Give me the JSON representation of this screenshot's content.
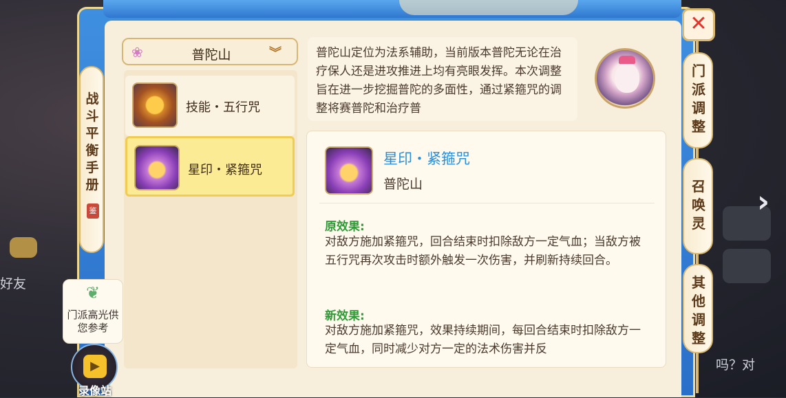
{
  "left_tab": {
    "label": "战斗平衡手册",
    "seal": "鉴"
  },
  "highlight": {
    "label": "门派高光供您参考"
  },
  "video": {
    "label": "录像站"
  },
  "dropdown": {
    "selected": "普陀山"
  },
  "skills": [
    {
      "label": "技能・五行咒"
    },
    {
      "label": "星印・紧箍咒"
    }
  ],
  "description": "普陀山定位为法系辅助，当前版本普陀无论在治疗保人还是进攻推进上均有亮眼发挥。本次调整旨在进一步挖掘普陀的多面性，通过紧箍咒的调整将赛普陀和治疗普",
  "detail": {
    "name": "星印・紧箍咒",
    "school": "普陀山",
    "old_heading": "原效果:",
    "old_text": "对敌方施加紧箍咒，回合结束时扣除敌方一定气血；当敌方被五行咒再次攻击时额外触发一次伤害，并刷新持续回合。",
    "new_heading": "新效果:",
    "new_text": "对敌方施加紧箍咒，效果持续期间，每回合结束时扣除敌方一定气血，同时减少对方一定的法术伤害并反"
  },
  "right_tabs": [
    {
      "label": "门派调整"
    },
    {
      "label": "召唤灵"
    },
    {
      "label": "其他调整"
    }
  ],
  "close_icon": "close-icon",
  "background": {
    "friends": "好友",
    "chat": "吗？对"
  }
}
